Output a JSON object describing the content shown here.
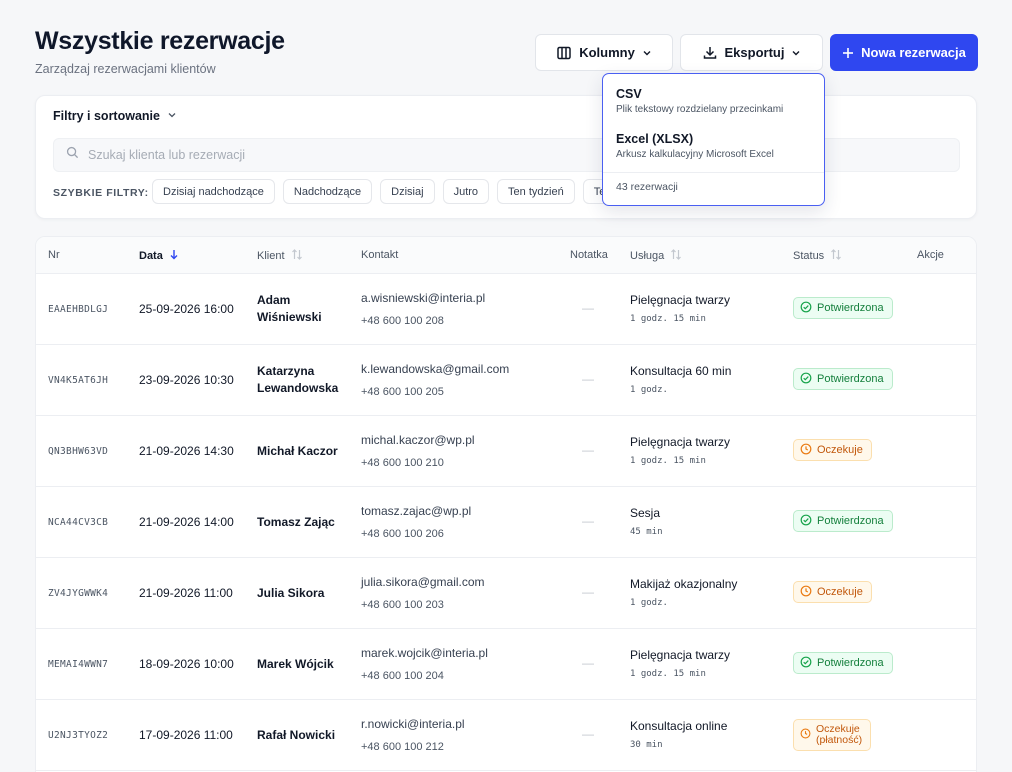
{
  "header": {
    "title": "Wszystkie rezerwacje",
    "subtitle": "Zarządzaj rezerwacjami klientów"
  },
  "toolbar": {
    "columns_label": "Kolumny",
    "export_label": "Eksportuj",
    "new_label": "Nowa rezerwacja",
    "primary_color": "#2f47f0"
  },
  "filters": {
    "toggle_label": "Filtry i sortowanie",
    "search_placeholder": "Szukaj klienta lub rezerwacji",
    "quick_label": "SZYBKIE FILTRY:",
    "quick": [
      "Dzisiaj nadchodzące",
      "Nadchodzące",
      "Dzisiaj",
      "Jutro",
      "Ten tydzień",
      "Te"
    ]
  },
  "export_menu": {
    "items": [
      {
        "title": "CSV",
        "desc": "Plik tekstowy rozdzielany przecinkami"
      },
      {
        "title": "Excel (XLSX)",
        "desc": "Arkusz kalkulacyjny Microsoft Excel"
      }
    ],
    "count": "43 rezerwacji"
  },
  "table": {
    "headers": {
      "nr": "Nr",
      "date": "Data",
      "client": "Klient",
      "contact": "Kontakt",
      "note": "Notatka",
      "service": "Usługa",
      "status": "Status",
      "actions": "Akcje"
    },
    "rows": [
      {
        "nr": "EAAEHBDLGJ",
        "date": "25-09-2026 16:00",
        "client": "Adam Wiśniewski",
        "email": "a.wisniewski@interia.pl",
        "phone": "+48 600 100 208",
        "note": "—",
        "service": "Pielęgnacja twarzy",
        "duration": "1 godz. 15 min",
        "status": "Potwierdzona",
        "status_type": "green"
      },
      {
        "nr": "VN4K5AT6JH",
        "date": "23-09-2026 10:30",
        "client": "Katarzyna Lewandowska",
        "email": "k.lewandowska@gmail.com",
        "phone": "+48 600 100 205",
        "note": "—",
        "service": "Konsultacja 60 min",
        "duration": "1 godz.",
        "status": "Potwierdzona",
        "status_type": "green"
      },
      {
        "nr": "QN3BHW63VD",
        "date": "21-09-2026 14:30",
        "client": "Michał Kaczor",
        "email": "michal.kaczor@wp.pl",
        "phone": "+48 600 100 210",
        "note": "—",
        "service": "Pielęgnacja twarzy",
        "duration": "1 godz. 15 min",
        "status": "Oczekuje",
        "status_type": "amber"
      },
      {
        "nr": "NCA44CV3CB",
        "date": "21-09-2026 14:00",
        "client": "Tomasz Zając",
        "email": "tomasz.zajac@wp.pl",
        "phone": "+48 600 100 206",
        "note": "—",
        "service": "Sesja",
        "duration": "45 min",
        "status": "Potwierdzona",
        "status_type": "green"
      },
      {
        "nr": "ZV4JYGWWK4",
        "date": "21-09-2026 11:00",
        "client": "Julia Sikora",
        "email": "julia.sikora@gmail.com",
        "phone": "+48 600 100 203",
        "note": "—",
        "service": "Makijaż okazjonalny",
        "duration": "1 godz.",
        "status": "Oczekuje",
        "status_type": "amber"
      },
      {
        "nr": "MEMAI4WWN7",
        "date": "18-09-2026 10:00",
        "client": "Marek Wójcik",
        "email": "marek.wojcik@interia.pl",
        "phone": "+48 600 100 204",
        "note": "—",
        "service": "Pielęgnacja twarzy",
        "duration": "1 godz. 15 min",
        "status": "Potwierdzona",
        "status_type": "green"
      },
      {
        "nr": "U2NJ3TYOZ2",
        "date": "17-09-2026 11:00",
        "client": "Rafał Nowicki",
        "email": "r.nowicki@interia.pl",
        "phone": "+48 600 100 212",
        "note": "—",
        "service": "Konsultacja online",
        "duration": "30 min",
        "status": "Oczekuje (płatność)",
        "status_line1": "Oczekuje",
        "status_line2": "(płatność)",
        "status_type": "amber"
      }
    ]
  }
}
